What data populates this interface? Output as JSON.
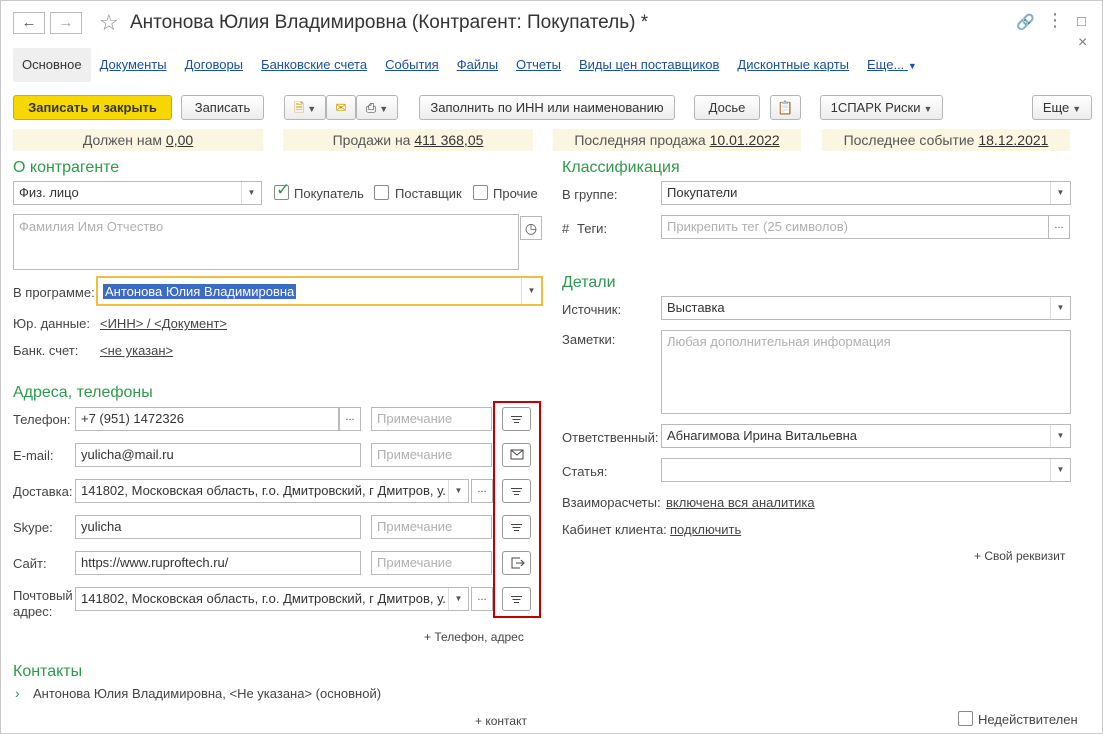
{
  "window": {
    "title": "Антонова Юлия Владимировна (Контрагент: Покупатель) *"
  },
  "tabs": [
    {
      "label": "Основное",
      "active": true
    },
    {
      "label": "Документы"
    },
    {
      "label": "Договоры"
    },
    {
      "label": "Банковские счета"
    },
    {
      "label": "События"
    },
    {
      "label": "Файлы"
    },
    {
      "label": "Отчеты"
    },
    {
      "label": "Виды цен поставщиков"
    },
    {
      "label": "Дисконтные карты"
    },
    {
      "label": "Еще..."
    }
  ],
  "toolbar": {
    "save_close": "Записать и закрыть",
    "save": "Записать",
    "fill_inn": "Заполнить по ИНН или наименованию",
    "dossier": "Досье",
    "spark": "1СПАРК Риски",
    "more": "Еще"
  },
  "info": {
    "owes_label": "Должен нам",
    "owes_value": "0,00",
    "sales_label": "Продажи на",
    "sales_value": "411 368,05",
    "last_sale_label": "Последняя продажа",
    "last_sale_value": "10.01.2022",
    "last_event_label": "Последнее событие",
    "last_event_value": "18.12.2021"
  },
  "about": {
    "section": "О контрагенте",
    "type_value": "Физ. лицо",
    "buyer_label": "Покупатель",
    "buyer_checked": true,
    "supplier_label": "Поставщик",
    "supplier_checked": false,
    "other_label": "Прочие",
    "other_checked": false,
    "name_placeholder": "Фамилия Имя Отчество",
    "in_program_label": "В программе:",
    "in_program_value": "Антонова Юлия Владимировна",
    "legal_label": "Юр. данные:",
    "legal_value": "<ИНН> / <Документ>",
    "bank_label": "Банк. счет:",
    "bank_value": "<не указан>"
  },
  "addresses": {
    "section": "Адреса, телефоны",
    "note_placeholder": "Примечание",
    "phone_label": "Телефон:",
    "phone_value": "+7 (951) 1472326",
    "email_label": "E-mail:",
    "email_value": "yulicha@mail.ru",
    "delivery_label": "Доставка:",
    "delivery_value": "141802, Московская область, г.о. Дмитровский, г Дмитров, у.",
    "skype_label": "Skype:",
    "skype_value": "yulicha",
    "site_label": "Сайт:",
    "site_value": "https://www.ruproftech.ru/",
    "postal_label_1": "Почтовый",
    "postal_label_2": "адрес:",
    "postal_value": "141802, Московская область, г.о. Дмитровский, г Дмитров, у.",
    "add_phone": "+ Телефон, адрес"
  },
  "contacts": {
    "section": "Контакты",
    "item": "Антонова Юлия Владимировна, <Не указана> (основной)",
    "add_contact": "+ контакт"
  },
  "classification": {
    "section": "Классификация",
    "group_label": "В группе:",
    "group_value": "Покупатели",
    "tags_label": "Теги:",
    "tags_hash": "#",
    "tags_placeholder": "Прикрепить тег (25 символов)"
  },
  "details": {
    "section": "Детали",
    "source_label": "Источник:",
    "source_value": "Выставка",
    "notes_label": "Заметки:",
    "notes_placeholder": "Любая дополнительная информация",
    "responsible_label": "Ответственный:",
    "responsible_value": "Абнагимова Ирина Витальевна",
    "article_label": "Статья:",
    "article_value": "",
    "settlements_label": "Взаиморасчеты:",
    "settlements_value": "включена вся аналитика",
    "cabinet_label": "Кабинет клиента:",
    "cabinet_value": "подключить",
    "add_attr": "+ Свой реквизит"
  },
  "footer": {
    "inactive_label": "Недействителен",
    "inactive_checked": false
  },
  "colors": {
    "accent_green": "#2f9a4b",
    "link_blue": "#1c4f9c",
    "primary_yellow": "#f6d800",
    "highlight_red": "#c00000",
    "info_bg": "#fbf6e1"
  }
}
